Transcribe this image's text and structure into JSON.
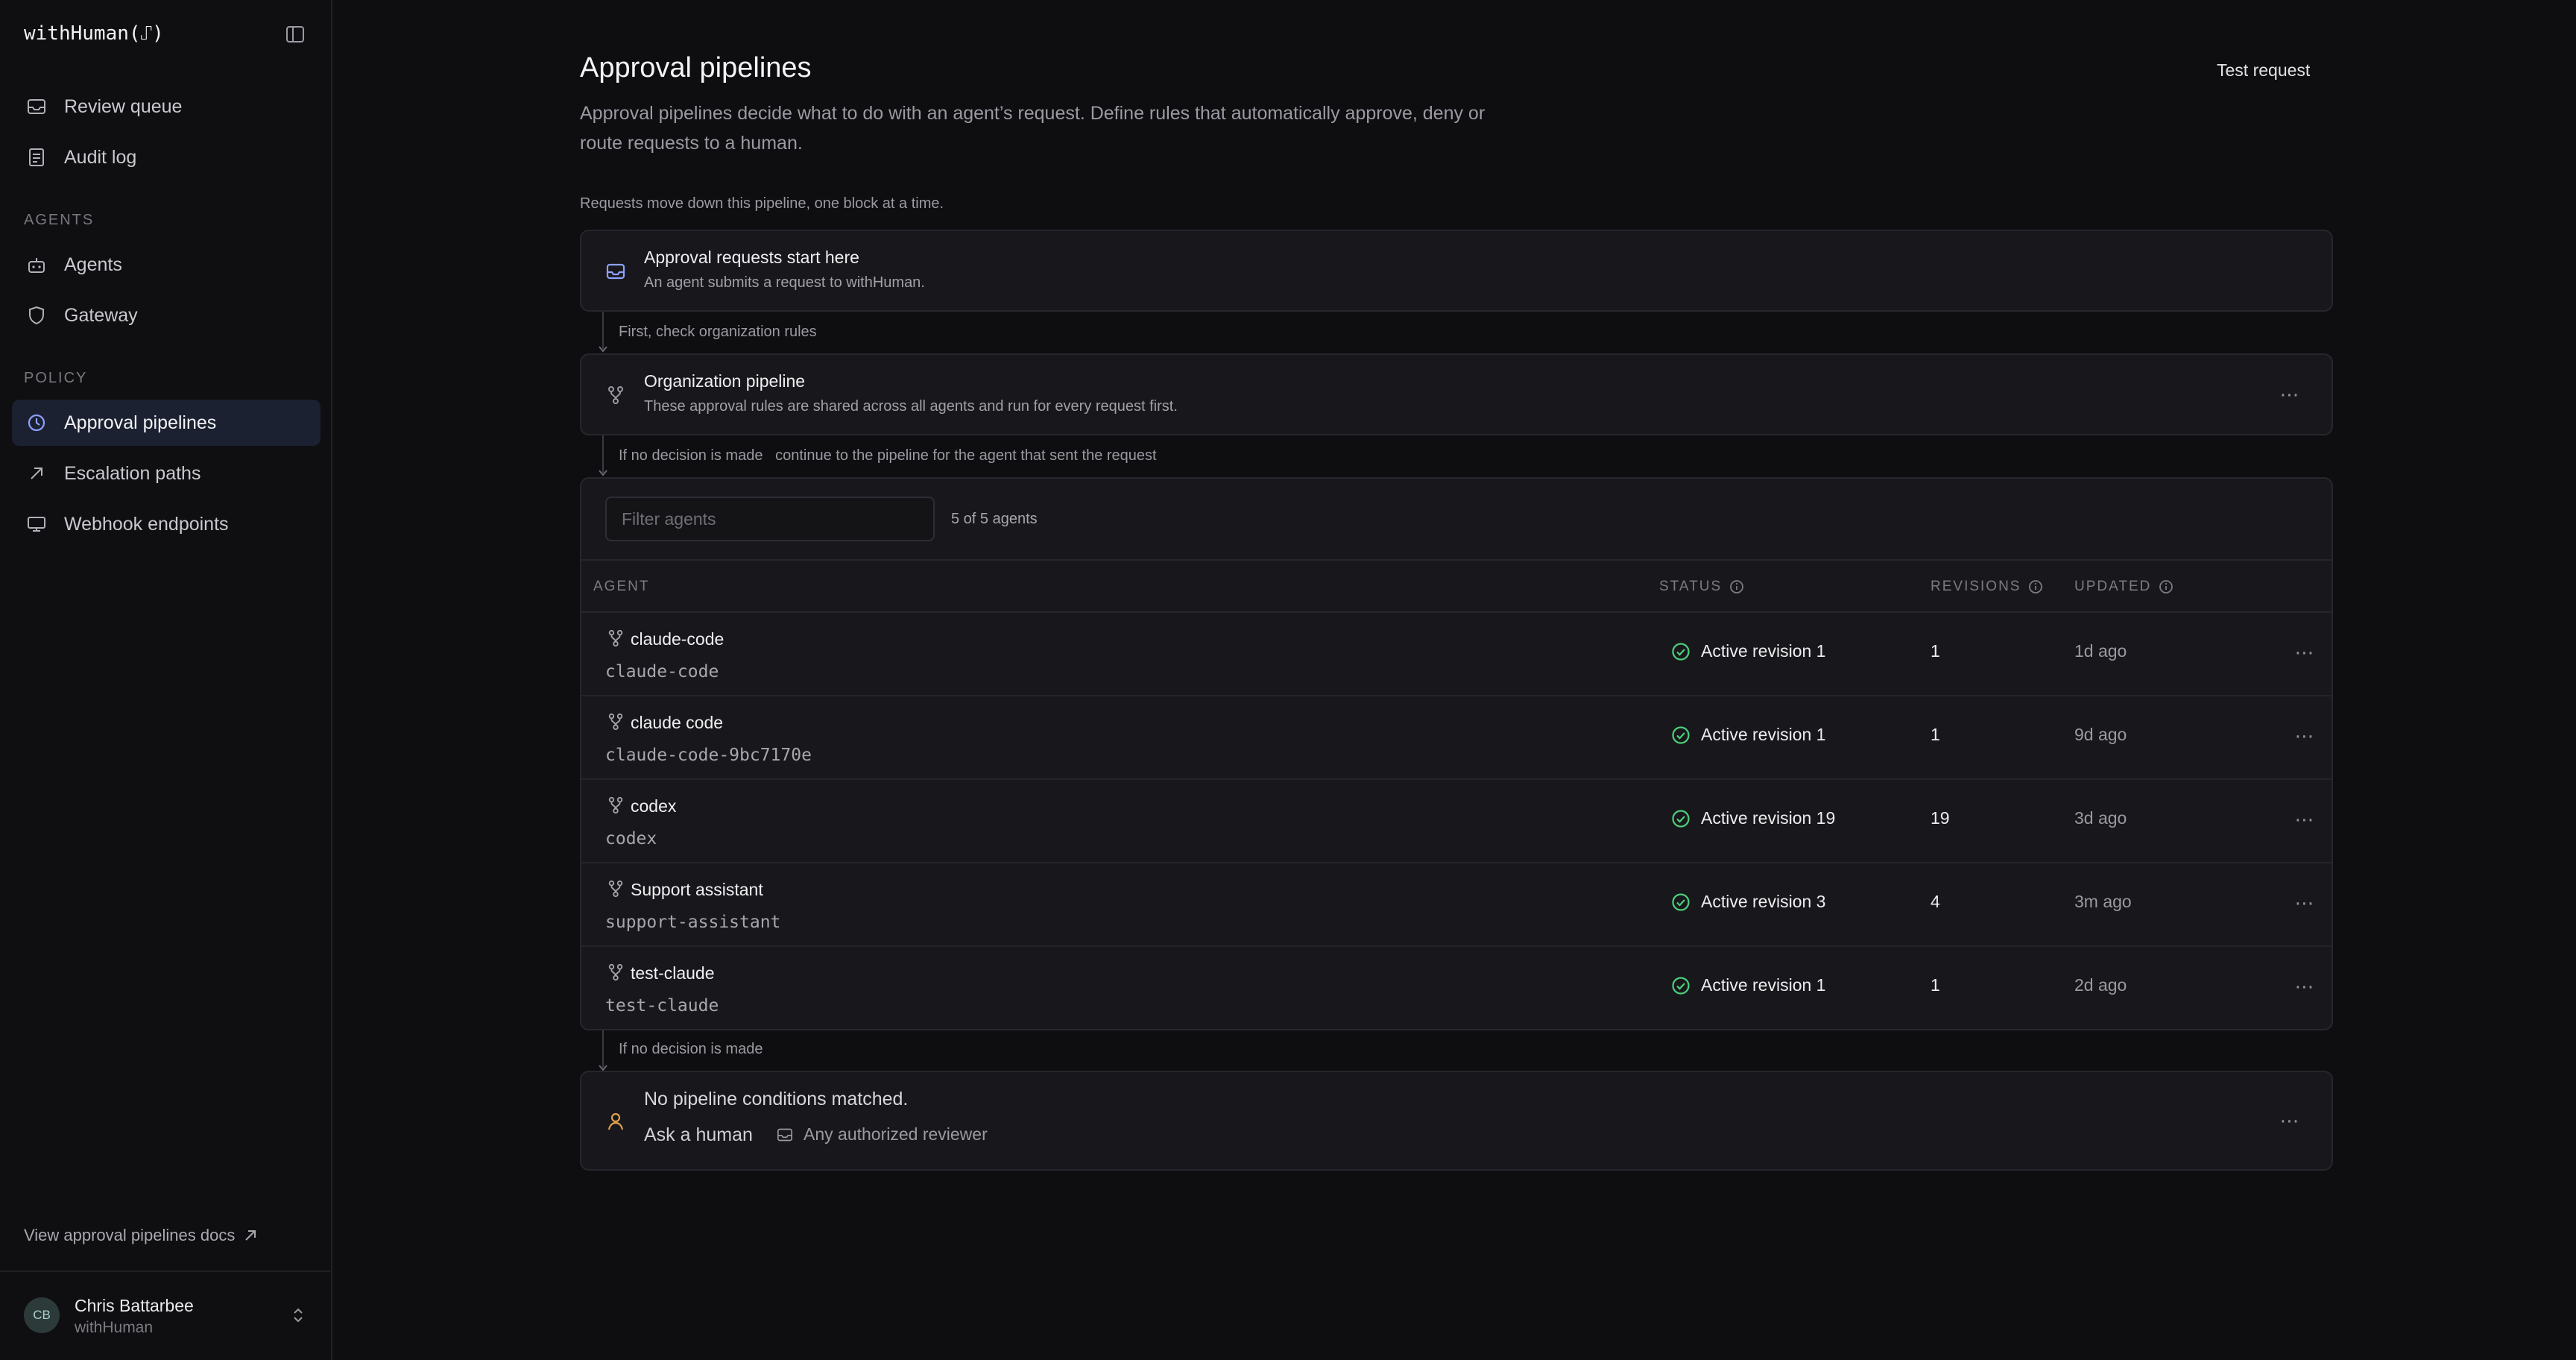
{
  "app": {
    "brand": "withHuman(⑀)",
    "colors": {
      "accent": "#8ea0ff",
      "success": "#4ccf7a",
      "warning": "#e0a050"
    }
  },
  "sidebar": {
    "items_top": [
      {
        "label": "Review queue",
        "icon": "inbox-icon"
      },
      {
        "label": "Audit log",
        "icon": "document-icon"
      }
    ],
    "section_agents": "AGENTS",
    "items_agents": [
      {
        "label": "Agents",
        "icon": "robot-icon"
      },
      {
        "label": "Gateway",
        "icon": "shield-icon"
      }
    ],
    "section_policy": "POLICY",
    "items_policy": [
      {
        "label": "Approval pipelines",
        "icon": "pipeline-icon",
        "active": true
      },
      {
        "label": "Escalation paths",
        "icon": "arrow-up-right-icon"
      },
      {
        "label": "Webhook endpoints",
        "icon": "monitor-icon"
      }
    ],
    "docs_link": "View approval pipelines docs",
    "user": {
      "initials": "CB",
      "name": "Chris Battarbee",
      "org": "withHuman"
    }
  },
  "main": {
    "title": "Approval pipelines",
    "description": "Approval pipelines decide what to do with an agent’s request. Define rules that automatically approve, deny or route requests to a human.",
    "test_request": "Test request",
    "flow_note": "Requests move down this pipeline, one block at a time.",
    "start": {
      "title": "Approval requests start here",
      "subtitle": "An agent submits a request to withHuman."
    },
    "connector1": "First, check organization rules",
    "org": {
      "title": "Organization pipeline",
      "subtitle": "These approval rules are shared across all agents and run for every request first."
    },
    "connector2": "If no decision is made   continue to the pipeline for the agent that sent the request",
    "agents_table": {
      "filter_placeholder": "Filter agents",
      "count": "5 of 5 agents",
      "headers": {
        "agent": "AGENT",
        "status": "STATUS",
        "revisions": "REVISIONS",
        "updated": "UPDATED"
      },
      "rows": [
        {
          "name": "claude-code",
          "slug": "claude-code",
          "status": "Active revision 1",
          "revisions": "1",
          "updated": "1d ago"
        },
        {
          "name": "claude code",
          "slug": "claude-code-9bc7170e",
          "status": "Active revision 1",
          "revisions": "1",
          "updated": "9d ago"
        },
        {
          "name": "codex",
          "slug": "codex",
          "status": "Active revision 19",
          "revisions": "19",
          "updated": "3d ago"
        },
        {
          "name": "Support assistant",
          "slug": "support-assistant",
          "status": "Active revision 3",
          "revisions": "4",
          "updated": "3m ago"
        },
        {
          "name": "test-claude",
          "slug": "test-claude",
          "status": "Active revision 1",
          "revisions": "1",
          "updated": "2d ago"
        }
      ]
    },
    "connector3": "If no decision is made",
    "fallback": {
      "title": "No pipeline conditions matched.",
      "action": "Ask a human",
      "reviewer": "Any authorized reviewer"
    }
  }
}
